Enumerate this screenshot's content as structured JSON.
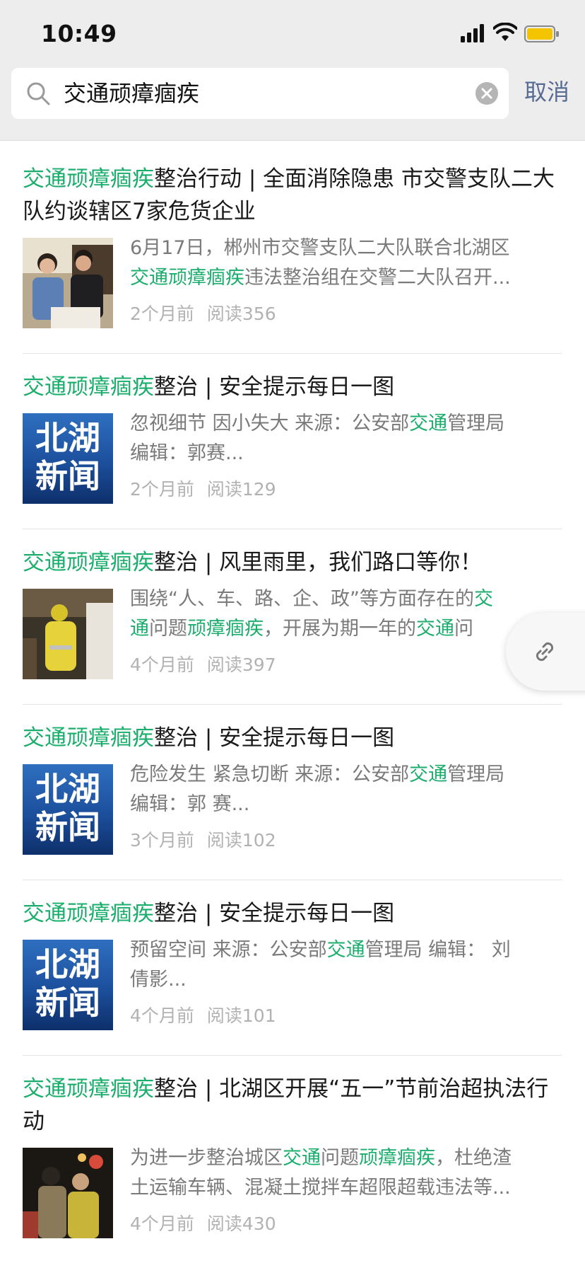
{
  "status": {
    "time": "10:49"
  },
  "search": {
    "query": "交通顽瘴痼疾",
    "cancel_label": "取消"
  },
  "results": [
    {
      "title_hl": "交通顽瘴痼疾",
      "title_rest": "整治行动 | 全面消除隐患 市交警支队二大队约谈辖区7家危货企业",
      "snippet_line1": "6月17日，郴州市交警支队二大队联合北湖区",
      "snippet_line2_hl": "交通顽瘴痼疾",
      "snippet_line2_rest": "违法整治组在交警二大队召开...",
      "time": "2个月前",
      "reads": "阅读356",
      "thumb": "photo-meeting"
    },
    {
      "title_hl": "交通顽瘴痼疾",
      "title_rest": "整治 | 安全提示每日一图",
      "snippet_line1_pre": "忽视细节 因小失大 来源：公安部",
      "snippet_line1_hl": "交通",
      "snippet_line1_post": "管理局",
      "snippet_line2": "编辑：郭赛...",
      "time": "2个月前",
      "reads": "阅读129",
      "thumb_text_1": "北湖",
      "thumb_text_2": "新闻"
    },
    {
      "title_hl": "交通顽瘴痼疾",
      "title_rest": "整治 | 风里雨里，我们路口等你！",
      "snippet_line1_pre": "围绕“人、车、路、企、政”等方面存在的",
      "snippet_line1_hl": "交",
      "snippet_line2_hl1": "通",
      "snippet_line2_mid": "问题",
      "snippet_line2_hl2": "顽瘴痼疾",
      "snippet_line2_mid2": "，开展为期一年的",
      "snippet_line2_hl3": "交通",
      "snippet_line2_post": "问",
      "time": "4个月前",
      "reads": "阅读397",
      "thumb": "photo-officer-night"
    },
    {
      "title_hl": "交通顽瘴痼疾",
      "title_rest": "整治 | 安全提示每日一图",
      "snippet_line1_pre": "危险发生 紧急切断 来源：公安部",
      "snippet_line1_hl": "交通",
      "snippet_line1_post": "管理局",
      "snippet_line2": "编辑：郭 赛...",
      "time": "3个月前",
      "reads": "阅读102",
      "thumb_text_1": "北湖",
      "thumb_text_2": "新闻"
    },
    {
      "title_hl": "交通顽瘴痼疾",
      "title_rest": "整治 | 安全提示每日一图",
      "snippet_line1_pre": "预留空间 来源：公安部",
      "snippet_line1_hl": "交通",
      "snippet_line1_post": "管理局 编辑： 刘",
      "snippet_line2": "倩影...",
      "time": "4个月前",
      "reads": "阅读101",
      "thumb_text_1": "北湖",
      "thumb_text_2": "新闻"
    },
    {
      "title_hl": "交通顽瘴痼疾",
      "title_rest": "整治 | 北湖区开展“五一”节前治超执法行动",
      "snippet_line1_pre": "为进一步整治城区",
      "snippet_line1_hl": "交通",
      "snippet_line1_mid": "问题",
      "snippet_line1_hl2": "顽瘴痼疾",
      "snippet_line1_post": "，杜绝渣",
      "snippet_line2": "土运输车辆、混凝土搅拌车超限超载违法等...",
      "time": "4个月前",
      "reads": "阅读430",
      "thumb": "photo-police-night"
    }
  ],
  "colors": {
    "highlight": "#1aad6b",
    "link": "#576b95",
    "meta": "#b2b2b2"
  },
  "icons": [
    "search-icon",
    "clear-icon",
    "link-icon",
    "signal-icon",
    "wifi-icon",
    "battery-icon"
  ]
}
